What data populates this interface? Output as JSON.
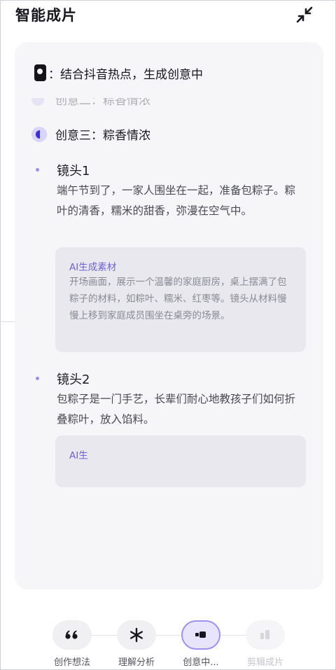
{
  "header": {
    "title": "智能成片"
  },
  "status": {
    "text": "：结合抖音热点，生成创意中"
  },
  "ideas": {
    "partial_label": "创意二：粽香情浓",
    "current_label": "创意三：粽香情浓"
  },
  "shots": [
    {
      "title": "镜头1",
      "description": "端午节到了，一家人围坐在一起，准备包粽子。粽叶的清香，糯米的甜香，弥漫在空气中。",
      "material_label": "AI生成素材",
      "material_text": "开场画面，展示一个温馨的家庭厨房，桌上摆满了包粽子的材料，如粽叶、糯米、红枣等。镜头从材料慢慢上移到家庭成员围坐在桌旁的场景。"
    },
    {
      "title": "镜头2",
      "description": "包粽子是一门手艺，长辈们耐心地教孩子们如何折叠粽叶，放入馅料。",
      "material_label": "AI生"
    }
  ],
  "bottom_nav": [
    {
      "label": "创作想法",
      "icon": "quote-icon",
      "state": "done"
    },
    {
      "label": "理解分析",
      "icon": "asterisk-icon",
      "state": "done"
    },
    {
      "label": "创意中...",
      "icon": "idea-icon",
      "state": "active"
    },
    {
      "label": "剪辑成片",
      "icon": "edit-icon",
      "state": "disabled"
    }
  ],
  "colors": {
    "accent": "#7060dc",
    "card_bg": "#f6f6f8",
    "material_bg": "#e8e8ee"
  }
}
